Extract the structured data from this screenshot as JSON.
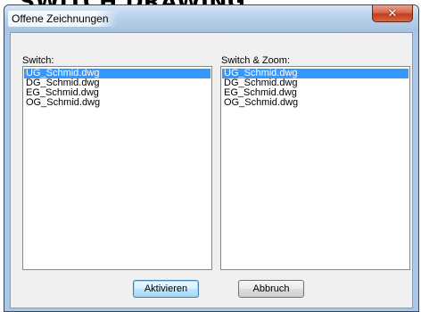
{
  "page": {
    "heading": "SWITCH DRAWING"
  },
  "window": {
    "title": "Offene Zeichnungen",
    "close_icon": "close-icon"
  },
  "switch_list": {
    "label": "Switch:",
    "items": [
      "UG_Schmid.dwg",
      "DG_Schmid.dwg",
      "EG_Schmid.dwg",
      "OG_Schmid.dwg"
    ],
    "selected": "UG_Schmid.dwg"
  },
  "zoom_list": {
    "label": "Switch & Zoom:",
    "items": [
      "UG_Schmid.dwg",
      "DG_Schmid.dwg",
      "EG_Schmid.dwg",
      "OG_Schmid.dwg"
    ],
    "selected": "UG_Schmid.dwg"
  },
  "buttons": {
    "activate_label": "Aktivieren",
    "cancel_label": "Abbruch"
  },
  "colors": {
    "selection": "#3399ff",
    "titlebar": "#b8d0ea",
    "close_button": "#c23d1d",
    "dialog_background": "#f0f0f0"
  }
}
